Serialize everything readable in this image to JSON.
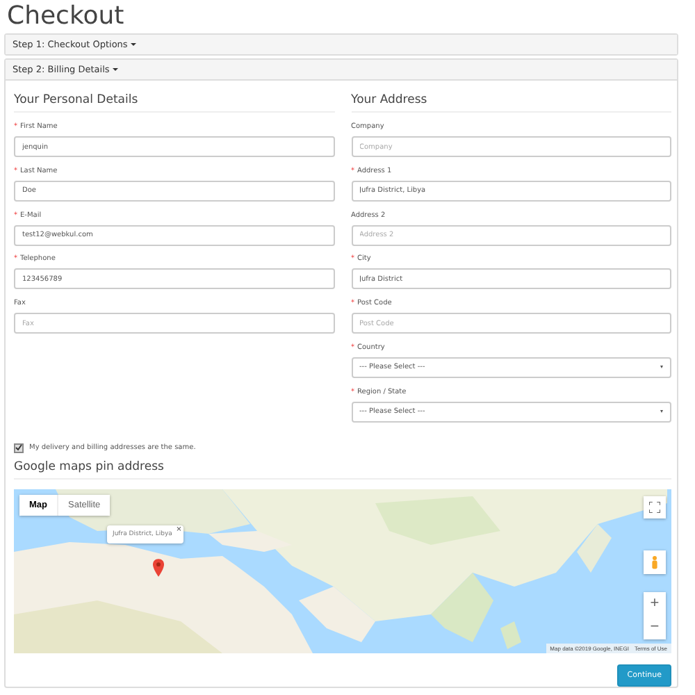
{
  "page_title": "Checkout",
  "steps": [
    {
      "label": "Step 1: Checkout Options",
      "expanded": false
    },
    {
      "label": "Step 2: Billing Details",
      "expanded": true
    }
  ],
  "columns": [
    {
      "heading": "Your Personal Details",
      "fields": [
        {
          "kind": "text",
          "required_mark": "*",
          "label": "First Name",
          "value": "jenquin"
        },
        {
          "kind": "text",
          "required_mark": "*",
          "label": "Last Name",
          "value": "Doe"
        },
        {
          "kind": "text",
          "required_mark": "*",
          "label": "E-Mail",
          "value": "test12@webkul.com"
        },
        {
          "kind": "text",
          "required_mark": "*",
          "label": "Telephone",
          "value": "123456789"
        },
        {
          "kind": "text",
          "label": "Fax",
          "placeholder": "Fax"
        }
      ]
    },
    {
      "heading": "Your Address",
      "fields": [
        {
          "kind": "text",
          "label": "Company",
          "placeholder": "Company"
        },
        {
          "kind": "text",
          "required_mark": "*",
          "label": "Address 1",
          "value": "Jufra District, Libya"
        },
        {
          "kind": "text",
          "label": "Address 2",
          "placeholder": "Address 2"
        },
        {
          "kind": "text",
          "required_mark": "*",
          "label": "City",
          "value": "Jufra District"
        },
        {
          "kind": "text",
          "required_mark": "*",
          "label": "Post Code",
          "placeholder": "Post Code"
        },
        {
          "kind": "select",
          "required_mark": "*",
          "label": "Country",
          "value": "--- Please Select ---"
        },
        {
          "kind": "select",
          "required_mark": "*",
          "label": "Region / State",
          "value": "--- Please Select ---"
        }
      ]
    }
  ],
  "same_address": {
    "label": "My delivery and billing addresses are the same.",
    "checked": true
  },
  "map": {
    "heading": "Google maps pin address",
    "map_types": [
      {
        "label": "Map",
        "selected": true
      },
      {
        "label": "Satellite",
        "selected": false
      }
    ],
    "info_window": "Jufra District, Libya",
    "close": "×",
    "zoom_in": "+",
    "zoom_out": "−",
    "attribution": "Map data ©2019 Google, INEGI",
    "terms": "Terms of Use"
  },
  "continue_button": "Continue"
}
